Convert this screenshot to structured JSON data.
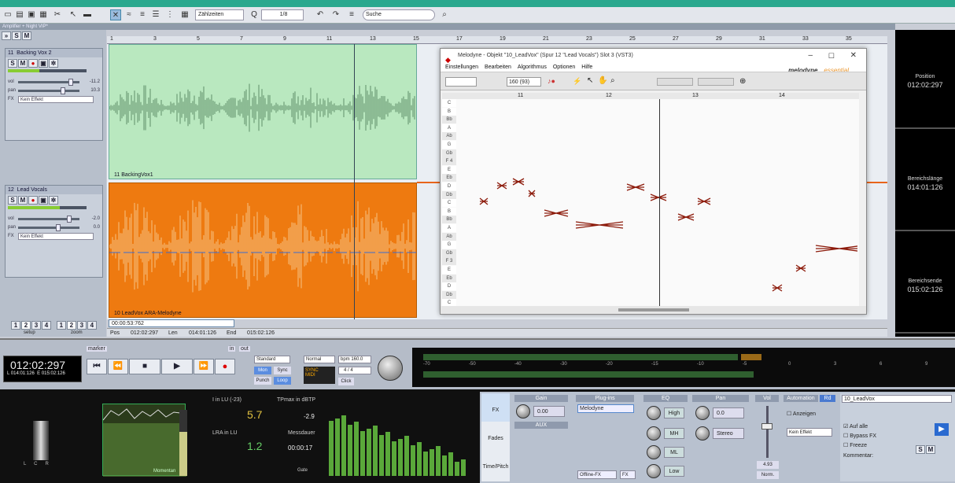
{
  "toolbar": {
    "snap": "Zählzeiten",
    "quant": "1/8",
    "search": "Suche"
  },
  "window_title": "Amplifier + Night VIP*",
  "tracks": [
    {
      "num": "11",
      "name": "Backing Vox 2",
      "vol": "-11.2",
      "pan": "10.3",
      "effect": "Kein Effekt"
    },
    {
      "num": "12",
      "name": "Lead Vocals",
      "vol": "-2.0",
      "pan": "0.0",
      "effect": "Kein Effekt"
    }
  ],
  "header_labels": {
    "vol": "vol",
    "pan": "pan",
    "fx": "FX"
  },
  "ruler": [
    "1",
    "3",
    "5",
    "7",
    "9",
    "11",
    "13",
    "15",
    "17",
    "19",
    "21",
    "23",
    "25",
    "27",
    "29",
    "31",
    "33",
    "35"
  ],
  "clips": [
    {
      "label": "11  BackingVox1"
    },
    {
      "label": "10  LeadVox  ARA-Melodyne"
    }
  ],
  "melodyne": {
    "title": "Melodyne - Objekt \"10_LeadVox\"  (Spur 12  \"Lead Vocals\") Slot 3 (VST3)",
    "menu": [
      "Einstellungen",
      "Bearbeiten",
      "Algorithmus",
      "Optionen",
      "Hilfe"
    ],
    "tempo": "160 (93)",
    "logo": "melodyne",
    "edition": "essential",
    "bars": [
      "11",
      "12",
      "13",
      "14"
    ],
    "notes": [
      "C",
      "B",
      "Bb",
      "A",
      "Ab",
      "G",
      "Gb",
      "F 4",
      "E",
      "Eb",
      "D",
      "Db",
      "C",
      "B",
      "Bb",
      "A",
      "Ab",
      "G",
      "Gb",
      "F 3",
      "E",
      "Eb",
      "D",
      "Db",
      "C"
    ]
  },
  "info": [
    {
      "title": "Position",
      "value": "012:02:297"
    },
    {
      "title": "Bereichslänge",
      "value": "014:01:126"
    },
    {
      "title": "Bereichsende",
      "value": "015:02:126"
    }
  ],
  "posbar": {
    "timecode": "00:00:53:762",
    "pos_label": "Pos",
    "pos": "012:02:297",
    "len_label": "Len",
    "len": "014:01:126",
    "end_label": "End",
    "end": "015:02:126"
  },
  "setup": {
    "setup": "setup",
    "zoom": "zoom"
  },
  "transport": {
    "time": "012:02:297",
    "sub_l": "L 014:01:126",
    "sub_e": "E 015:02:126",
    "marker": "marker",
    "in": "in",
    "out": "out",
    "mode": "Standard",
    "mon": "Mon",
    "sync": "Sync",
    "punch": "Punch",
    "loop": "Loop",
    "normal": "Normal",
    "bpm": "bpm  160.0",
    "sig": "4 / 4",
    "click": "Click"
  },
  "meter_scale": [
    "-70",
    "-50",
    "-40",
    "-30",
    "-20",
    "-15",
    "-10",
    "-5",
    "0",
    "3",
    "6",
    "9"
  ],
  "loudness": {
    "in_lu": "I in LU (-23)",
    "in_val": "5.7",
    "lra": "LRA in LU",
    "lra_val": "1.2",
    "tp": "TPmax in dBTP",
    "tp_val": "-2.9",
    "dur": "Messdauer",
    "dur_val": "00:00:17",
    "gate": "Gate",
    "moment": "Momentan",
    "lcr": "L      C      R"
  },
  "mixer": {
    "gain": "Gain",
    "gain_val": "0.00",
    "aux": "AUX",
    "plugins": "Plug-ins",
    "plugin1": "Melodyne",
    "offline": "Offline-FX",
    "fx": "FX",
    "eq": "EQ",
    "high": "High",
    "mh": "MH",
    "ml": "ML",
    "low": "Low",
    "pan": "Pan",
    "pan_val": "0.0",
    "stereo": "Stereo",
    "vol": "Vol",
    "vol_val": "4.93",
    "norm": "Norm.",
    "automation": "Automation",
    "rd": "Rd",
    "anzeigen": "Anzeigen",
    "effect": "Kein Effekt",
    "tab_fx": "FX",
    "tab_fades": "Fades",
    "tab_time": "Time/Pitch"
  },
  "channel": {
    "name": "10_LeadVox",
    "auf_alle": "Auf alle",
    "bypass": "Bypass FX",
    "freeze": "Freeze",
    "kommentar": "Kommentar:"
  }
}
